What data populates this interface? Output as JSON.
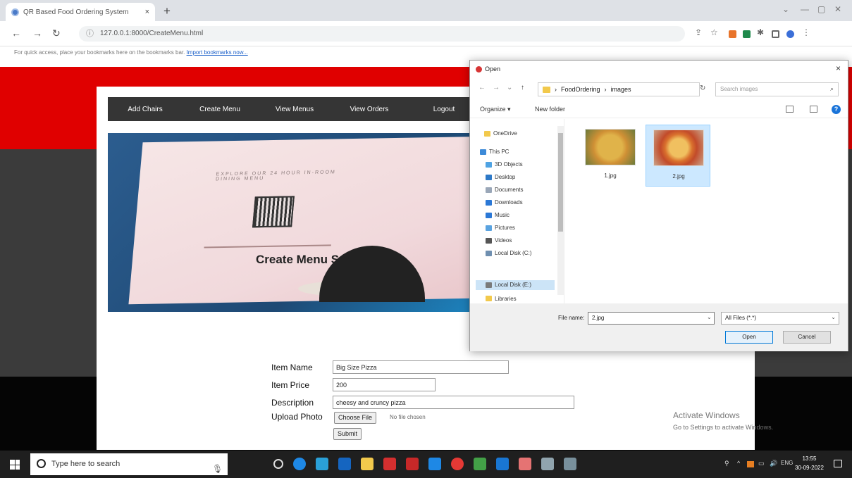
{
  "browser": {
    "tab_title": "QR Based Food Ordering System",
    "tab_close": "×",
    "new_tab": "+",
    "url": "127.0.0.1:8000/CreateMenu.html",
    "bookmarks_text": "For quick access, place your bookmarks here on the bookmarks bar.",
    "bookmarks_link": "Import bookmarks now..."
  },
  "page": {
    "nav": [
      "Add Chairs",
      "Create Menu",
      "View Menus",
      "View Orders",
      "Logout"
    ],
    "hero_caption": "EXPLORE OUR 24 HOUR IN-ROOM DINING MENU",
    "form_title": "Create Menu Scr",
    "labels": {
      "item_name": "Item Name",
      "item_price": "Item Price",
      "description": "Description",
      "upload_photo": "Upload Photo"
    },
    "values": {
      "item_name": "Big Size Pizza",
      "item_price": "200",
      "description": "cheesy and cruncy pizza"
    },
    "choose_file": "Choose File",
    "no_file": "No file chosen",
    "submit": "Submit",
    "watermark_title": "Activate Windows",
    "watermark_sub": "Go to Settings to activate Windows."
  },
  "dialog": {
    "title": "Open",
    "close": "×",
    "path": [
      "FoodOrdering",
      "images"
    ],
    "search_placeholder": "Search images",
    "organize": "Organize ▾",
    "new_folder": "New folder",
    "nav_items": [
      {
        "label": "OneDrive",
        "icon": "onedrive-icon",
        "color": "#f2c94c"
      },
      {
        "label": "This PC",
        "icon": "pc-icon",
        "color": "#3c8ad8"
      },
      {
        "label": "3D Objects",
        "icon": "cube-icon",
        "color": "#4fa3e3"
      },
      {
        "label": "Desktop",
        "icon": "desktop-icon",
        "color": "#2d79c7"
      },
      {
        "label": "Documents",
        "icon": "documents-icon",
        "color": "#9aa7b8"
      },
      {
        "label": "Downloads",
        "icon": "download-icon",
        "color": "#2b78d6"
      },
      {
        "label": "Music",
        "icon": "music-icon",
        "color": "#2b78d6"
      },
      {
        "label": "Pictures",
        "icon": "pictures-icon",
        "color": "#5aa3e0"
      },
      {
        "label": "Videos",
        "icon": "videos-icon",
        "color": "#555555"
      },
      {
        "label": "Local Disk (C:)",
        "icon": "drive-icon",
        "color": "#6f8fb0"
      },
      {
        "label": "Local Disk (E:)",
        "icon": "drive-icon",
        "color": "#7a7a7a"
      },
      {
        "label": "Libraries",
        "icon": "libraries-icon",
        "color": "#f2c94c"
      }
    ],
    "files": [
      {
        "name": "1.jpg",
        "selected": false
      },
      {
        "name": "2.jpg",
        "selected": true
      }
    ],
    "file_name_label": "File name:",
    "file_name_value": "2.jpg",
    "file_type": "All Files (*.*)",
    "open_button": "Open",
    "cancel_button": "Cancel"
  },
  "taskbar": {
    "search_placeholder": "Type here to search",
    "time": "13:55",
    "date": "30-09-2022",
    "lang": "ENG"
  }
}
